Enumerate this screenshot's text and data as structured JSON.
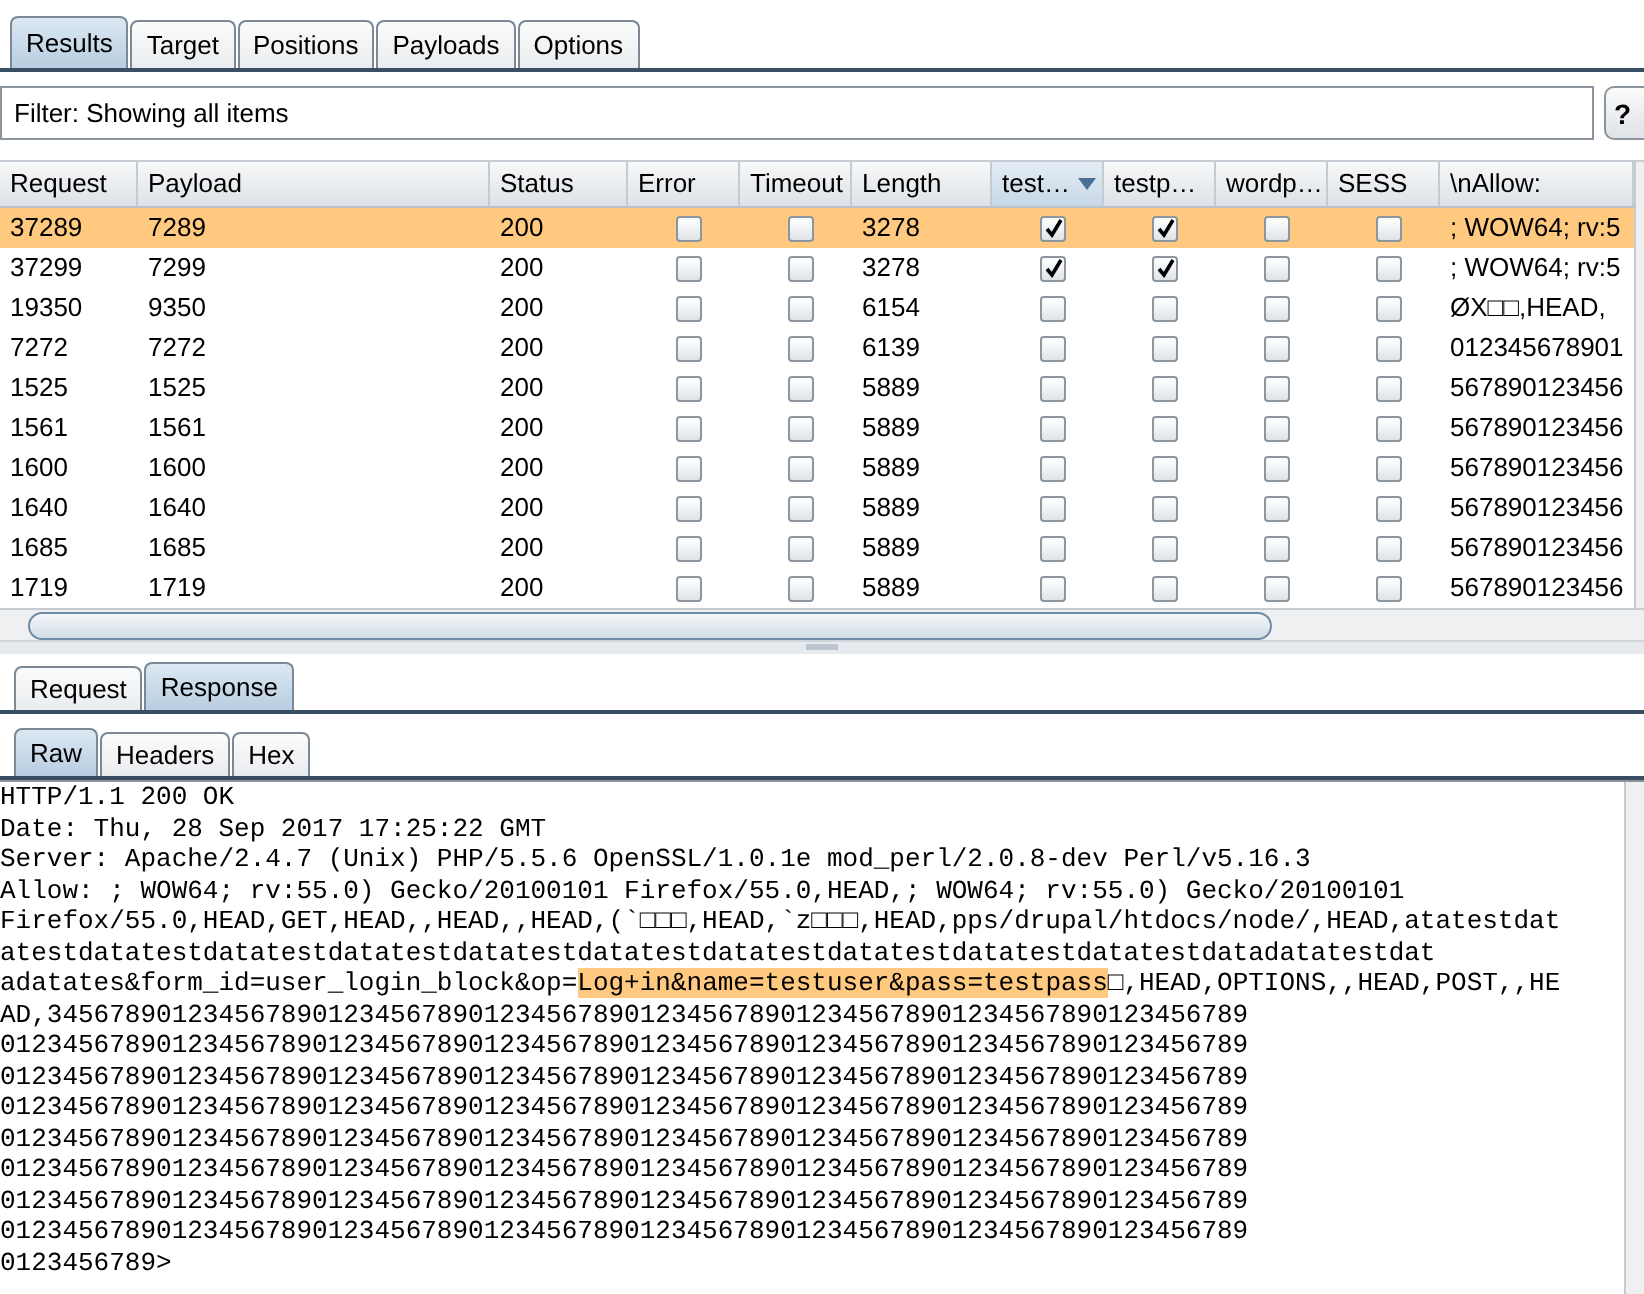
{
  "top_tabs": [
    {
      "label": "Results",
      "selected": true
    },
    {
      "label": "Target",
      "selected": false
    },
    {
      "label": "Positions",
      "selected": false
    },
    {
      "label": "Payloads",
      "selected": false
    },
    {
      "label": "Options",
      "selected": false
    }
  ],
  "filter": {
    "text": "Filter: Showing all items",
    "help_button": "?"
  },
  "table": {
    "columns": [
      {
        "label": "Request",
        "kind": "text",
        "sorted": false
      },
      {
        "label": "Payload",
        "kind": "text",
        "sorted": false
      },
      {
        "label": "Status",
        "kind": "text",
        "sorted": false
      },
      {
        "label": "Error",
        "kind": "check",
        "sorted": false
      },
      {
        "label": "Timeout",
        "kind": "check",
        "sorted": false
      },
      {
        "label": "Length",
        "kind": "text",
        "sorted": false
      },
      {
        "label": "test…",
        "kind": "check",
        "sorted": true
      },
      {
        "label": "testp…",
        "kind": "check",
        "sorted": false
      },
      {
        "label": "wordp…",
        "kind": "check",
        "sorted": false
      },
      {
        "label": "SESS",
        "kind": "check",
        "sorted": false
      },
      {
        "label": "\\nAllow:",
        "kind": "text",
        "sorted": false
      }
    ],
    "rows": [
      {
        "selected": true,
        "cells": [
          "37289",
          "7289",
          "200",
          false,
          false,
          "3278",
          true,
          true,
          false,
          false,
          "; WOW64; rv:5"
        ]
      },
      {
        "selected": false,
        "cells": [
          "37299",
          "7299",
          "200",
          false,
          false,
          "3278",
          true,
          true,
          false,
          false,
          "; WOW64; rv:5"
        ]
      },
      {
        "selected": false,
        "cells": [
          "19350",
          "9350",
          "200",
          false,
          false,
          "6154",
          false,
          false,
          false,
          false,
          "ØX□□,HEAD,"
        ]
      },
      {
        "selected": false,
        "cells": [
          "7272",
          "7272",
          "200",
          false,
          false,
          "6139",
          false,
          false,
          false,
          false,
          "012345678901"
        ]
      },
      {
        "selected": false,
        "cells": [
          "1525",
          "1525",
          "200",
          false,
          false,
          "5889",
          false,
          false,
          false,
          false,
          "567890123456"
        ]
      },
      {
        "selected": false,
        "cells": [
          "1561",
          "1561",
          "200",
          false,
          false,
          "5889",
          false,
          false,
          false,
          false,
          "567890123456"
        ]
      },
      {
        "selected": false,
        "cells": [
          "1600",
          "1600",
          "200",
          false,
          false,
          "5889",
          false,
          false,
          false,
          false,
          "567890123456"
        ]
      },
      {
        "selected": false,
        "cells": [
          "1640",
          "1640",
          "200",
          false,
          false,
          "5889",
          false,
          false,
          false,
          false,
          "567890123456"
        ]
      },
      {
        "selected": false,
        "cells": [
          "1685",
          "1685",
          "200",
          false,
          false,
          "5889",
          false,
          false,
          false,
          false,
          "567890123456"
        ]
      },
      {
        "selected": false,
        "cells": [
          "1719",
          "1719",
          "200",
          false,
          false,
          "5889",
          false,
          false,
          false,
          false,
          "567890123456"
        ]
      }
    ]
  },
  "message_tabs": [
    {
      "label": "Request",
      "selected": false
    },
    {
      "label": "Response",
      "selected": true
    }
  ],
  "view_tabs": [
    {
      "label": "Raw",
      "selected": true
    },
    {
      "label": "Headers",
      "selected": false
    },
    {
      "label": "Hex",
      "selected": false
    }
  ],
  "response_lines": [
    {
      "text": "HTTP/1.1 200 OK"
    },
    {
      "text": "Date: Thu, 28 Sep 2017 17:25:22 GMT"
    },
    {
      "text": "Server: Apache/2.4.7 (Unix) PHP/5.5.6 OpenSSL/1.0.1e mod_perl/2.0.8-dev Perl/v5.16.3"
    },
    {
      "text": "Allow: ; WOW64; rv:55.0) Gecko/20100101 Firefox/55.0,HEAD,; WOW64; rv:55.0) Gecko/20100101"
    },
    {
      "text": "Firefox/55.0,HEAD,GET,HEAD,,HEAD,,HEAD,(`□□□,HEAD,`z□□□,HEAD,pps/drupal/htdocs/node/,HEAD,atatestdat"
    },
    {
      "text": "atestdatatestdatatestdatatestdatatestdatatestdatatestdatatestdatatestdatatestdatadatatestdat"
    },
    {
      "segments": [
        {
          "text": "adatates&form_id=user_login_block&op=",
          "highlighted": false
        },
        {
          "text": "Log+in&name=testuser&pass=testpass",
          "highlighted": true
        },
        {
          "text": "□,HEAD,OPTIONS,,HEAD,POST,,HE",
          "highlighted": false
        }
      ]
    },
    {
      "text": "AD,34567890123456789012345678901234567890123456789012345678901234567890123456789"
    },
    {
      "text": "01234567890123456789012345678901234567890123456789012345678901234567890123456789"
    },
    {
      "text": "01234567890123456789012345678901234567890123456789012345678901234567890123456789"
    },
    {
      "text": "01234567890123456789012345678901234567890123456789012345678901234567890123456789"
    },
    {
      "text": "01234567890123456789012345678901234567890123456789012345678901234567890123456789"
    },
    {
      "text": "01234567890123456789012345678901234567890123456789012345678901234567890123456789"
    },
    {
      "text": "01234567890123456789012345678901234567890123456789012345678901234567890123456789"
    },
    {
      "text": "01234567890123456789012345678901234567890123456789012345678901234567890123456789"
    },
    {
      "text": "0123456789>"
    }
  ]
}
